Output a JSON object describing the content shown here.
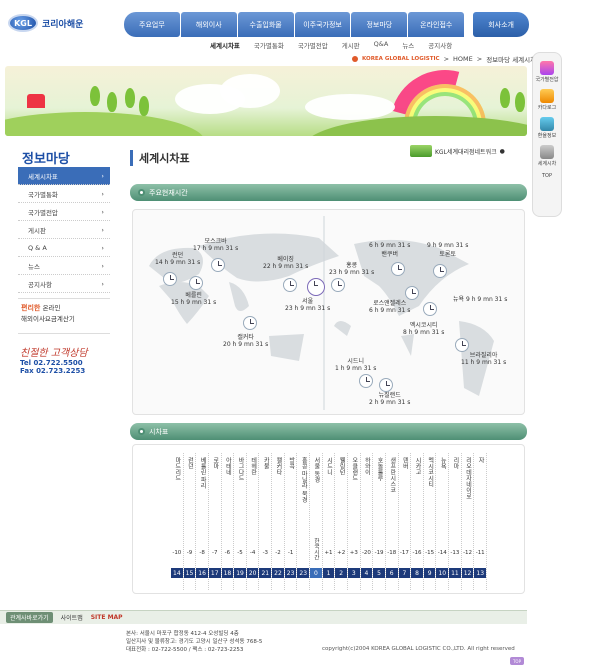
{
  "logo": {
    "badge": "KGL",
    "name": "코리아해운"
  },
  "gnb": [
    "주요업무",
    "해외이사",
    "수출입화물",
    "이주국가정보",
    "정보마당",
    "온라인접수",
    "회사소개"
  ],
  "subnav": {
    "active": "세계시차표",
    "items": [
      "국가별통화",
      "국가별전압",
      "게시판",
      "Q&A",
      "뉴스",
      "공지사항"
    ]
  },
  "path": {
    "company": "KOREA GLOBAL LOGISTIC",
    "home": "HOME",
    "trail": "정보마당 세계시차표"
  },
  "quick_menu": [
    "국가별전압",
    "카다로그",
    "환율정보",
    "세계시차",
    "TOP"
  ],
  "sidebar": {
    "title": "정보마당",
    "items": [
      "세계시차표",
      "국가별통화",
      "국가별전압",
      "게시판",
      "Q & A",
      "뉴스",
      "공지사항"
    ],
    "promo_line1": "편리한",
    "promo_word": "온라인",
    "promo_line2": "해외이사요금계산기",
    "script": "친절한 고객상담",
    "tel_label": "Tel",
    "tel": "02.722.5500",
    "fax_label": "Fax",
    "fax": "02.723.2253"
  },
  "main": {
    "title": "세계시차표",
    "link": "KGL세계대리점네트워크",
    "section1": "주요현재시간",
    "section2": "시차표"
  },
  "cities": [
    {
      "name": "런던",
      "time": "14 h  9 mn  31 s"
    },
    {
      "name": "모스크바",
      "time": "17 h  9 mn  31 s"
    },
    {
      "name": "베를린",
      "time": "15 h  9 mn  31 s"
    },
    {
      "name": "베이징",
      "time": "22 h  9 mn  31 s"
    },
    {
      "name": "홍콩",
      "time": "23 h  9 mn  31 s"
    },
    {
      "name": "서울",
      "time": "23 h  9 mn  31 s"
    },
    {
      "name": "캘커타",
      "time": "20 h  9 mn  31 s"
    },
    {
      "name": "시드니",
      "time": "1 h  9 mn  31 s"
    },
    {
      "name": "뉴질랜드",
      "time": "2 h  9 mn  31 s"
    },
    {
      "name": "밴쿠버",
      "time": "6 h  9 mn  31 s"
    },
    {
      "name": "토론토",
      "time": "9 h  9 mn  31 s"
    },
    {
      "name": "로스앤젤레스",
      "time": "6 h  9 mn  31 s"
    },
    {
      "name": "뉴욕",
      "time": "9 h  9 mn  31 s"
    },
    {
      "name": "멕시코시티",
      "time": "8 h  9 mn  31 s"
    },
    {
      "name": "브라질리아",
      "time": "11 h  9 mn  31 s"
    }
  ],
  "timetable": [
    {
      "city": "마드리드",
      "offset": "-10",
      "hour": "14"
    },
    {
      "city": "런던",
      "offset": "-9",
      "hour": "15"
    },
    {
      "city": "베를린 파리",
      "offset": "-8",
      "hour": "16"
    },
    {
      "city": "로마",
      "offset": "-7",
      "hour": "17"
    },
    {
      "city": "아테네",
      "offset": "-6",
      "hour": "18"
    },
    {
      "city": "바그다드",
      "offset": "-5",
      "hour": "19"
    },
    {
      "city": "테헤란",
      "offset": "-4",
      "hour": "20"
    },
    {
      "city": "카불",
      "offset": "-3",
      "hour": "21"
    },
    {
      "city": "캘커타",
      "offset": "-2",
      "hour": "22"
    },
    {
      "city": "방콕",
      "offset": "-1",
      "hour": "23"
    },
    {
      "city": "홍콩 마닐라 북경",
      "offset": "",
      "hour": "23"
    },
    {
      "city": "서울 동경",
      "offset": "한국시간",
      "hour": "0"
    },
    {
      "city": "시드니",
      "offset": "+1",
      "hour": "1"
    },
    {
      "city": "웰링턴",
      "offset": "+2",
      "hour": "2"
    },
    {
      "city": "오클랜드",
      "offset": "+3",
      "hour": "3"
    },
    {
      "city": "하와이",
      "offset": "-20",
      "hour": "4"
    },
    {
      "city": "호놀룰루",
      "offset": "-19",
      "hour": "5"
    },
    {
      "city": "샌프란시스코",
      "offset": "-18",
      "hour": "6"
    },
    {
      "city": "덴버",
      "offset": "-17",
      "hour": "7"
    },
    {
      "city": "시카고",
      "offset": "-16",
      "hour": "8"
    },
    {
      "city": "멕시코시티",
      "offset": "-15",
      "hour": "9"
    },
    {
      "city": "뉴욕",
      "offset": "-14",
      "hour": "10"
    },
    {
      "city": "리마",
      "offset": "-13",
      "hour": "11"
    },
    {
      "city": "리오데자네이로",
      "offset": "-12",
      "hour": "12"
    },
    {
      "city": "자",
      "offset": "-11",
      "hour": "13"
    }
  ],
  "footer": {
    "family_site": "관계사바로가기",
    "site_label": "사이트맵",
    "sitemap": "SITE MAP",
    "addr1": "본사: 서울시 마포구 합정동 412-4 오성빌딩 4층",
    "addr2": "일산지사 및 물류창고: 경기도 고양시 일산구 성석동 768-5",
    "addr3": "대표전화 : 02-722-5500 / 팩스 : 02-723-2253",
    "copyright": "copyright(c)2004 KOREA GLOBAL LOGISTIC CO.,LTD. All right reserved",
    "top": "TOP"
  }
}
